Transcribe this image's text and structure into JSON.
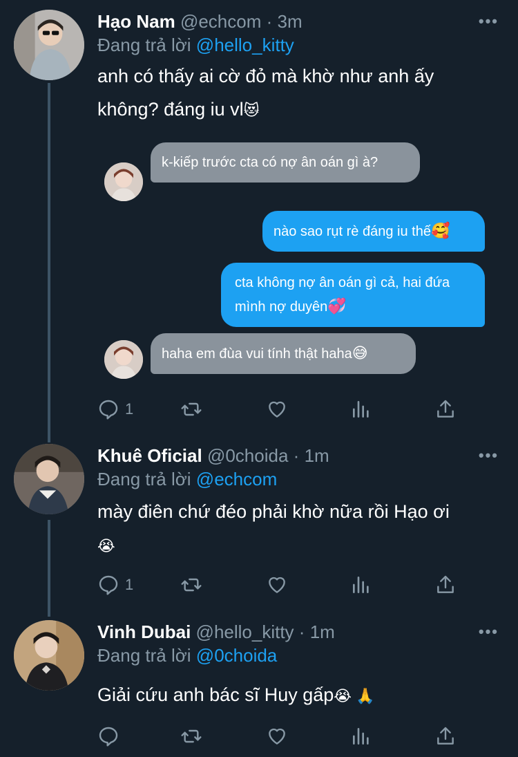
{
  "tweets": [
    {
      "name": "Hạo Nam",
      "handle": "@echcom",
      "dot": "·",
      "time": "3m",
      "reply_prefix": "Đang trả lời",
      "reply_to": "@hello_kitty",
      "text": "anh có thấy ai cờ đỏ mà khờ như anh ấy không? đáng iu vl",
      "emoji": "😻",
      "reply_count": "1",
      "embed": {
        "messages": [
          {
            "from": "them",
            "text": "k-kiếp trước cta có nợ ân oán gì à?"
          },
          {
            "from": "me",
            "text": "nào sao rụt rè đáng iu thế",
            "emoji": "🥰"
          },
          {
            "from": "me",
            "text": "cta không nợ ân oán gì cả, hai đứa mình nợ duyên",
            "emoji": "💞"
          },
          {
            "from": "them",
            "text": "haha em đùa vui tính thật haha",
            "emoji": "😅"
          }
        ]
      }
    },
    {
      "name": "Khuê Oficial",
      "handle": "@0choida",
      "dot": "·",
      "time": "1m",
      "reply_prefix": "Đang trả lời",
      "reply_to": "@echcom",
      "text": "mày điên chứ đéo phải khờ nữa rồi Hạo ơi",
      "emoji": "😭",
      "reply_count": "1"
    },
    {
      "name": "Vinh Dubai",
      "handle": "@hello_kitty",
      "dot": "·",
      "time": "1m",
      "reply_prefix": "Đang trả lời",
      "reply_to": "@0choida",
      "text": "Giải cứu anh bác sĩ Huy gấp",
      "emoji": "😭 🙏",
      "reply_count": ""
    }
  ],
  "icons": {
    "reply": "reply-icon",
    "retweet": "retweet-icon",
    "like": "heart-icon",
    "analytics": "analytics-icon",
    "share": "share-icon",
    "more": "more-icon"
  },
  "colors": {
    "background": "#15202b",
    "accent": "#1da1f2",
    "muted": "#8899a6",
    "bubble_gray": "#8a939c"
  }
}
